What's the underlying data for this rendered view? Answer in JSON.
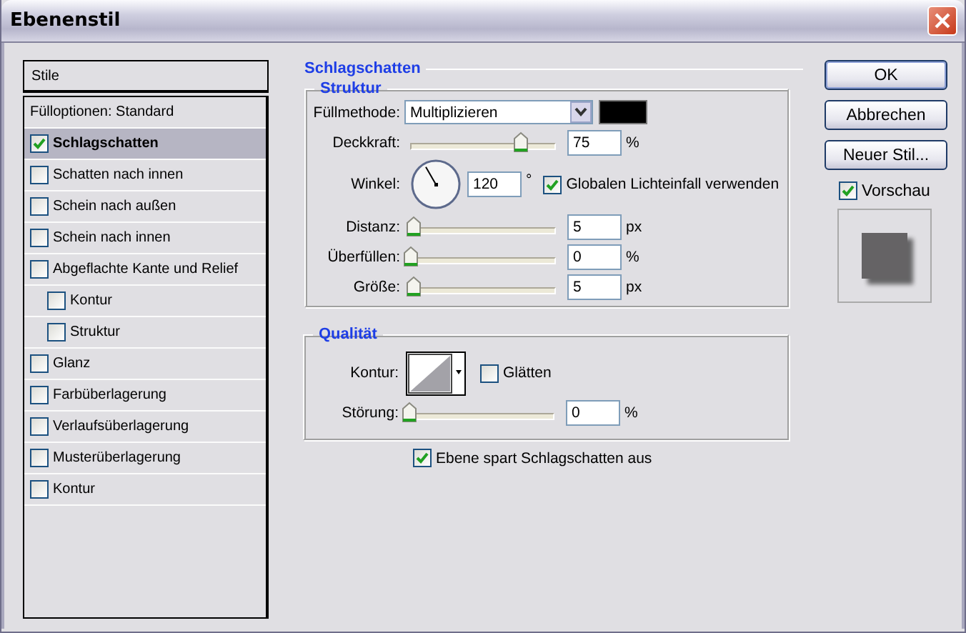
{
  "window": {
    "title": "Ebenenstil"
  },
  "styles": {
    "header": "Stile",
    "items": [
      {
        "label": "Fülloptionen: Standard",
        "kind": "option",
        "selected": false
      },
      {
        "label": "Schlagschatten",
        "kind": "style",
        "checked": true,
        "selected": true
      },
      {
        "label": "Schatten nach innen",
        "kind": "style",
        "checked": false,
        "selected": false
      },
      {
        "label": "Schein nach außen",
        "kind": "style",
        "checked": false,
        "selected": false
      },
      {
        "label": "Schein nach innen",
        "kind": "style",
        "checked": false,
        "selected": false
      },
      {
        "label": "Abgeflachte Kante und Relief",
        "kind": "style",
        "checked": false,
        "selected": false,
        "children": [
          {
            "label": "Kontur",
            "kind": "style",
            "checked": false,
            "selected": false
          },
          {
            "label": "Struktur",
            "kind": "style",
            "checked": false,
            "selected": false
          }
        ]
      },
      {
        "label": "Glanz",
        "kind": "style",
        "checked": false,
        "selected": false
      },
      {
        "label": "Farbüberlagerung",
        "kind": "style",
        "checked": false,
        "selected": false
      },
      {
        "label": "Verlaufsüberlagerung",
        "kind": "style",
        "checked": false,
        "selected": false
      },
      {
        "label": "Musterüberlagerung",
        "kind": "style",
        "checked": false,
        "selected": false
      },
      {
        "label": "Kontur",
        "kind": "style",
        "checked": false,
        "selected": false
      }
    ]
  },
  "panel": {
    "title": "Schlagschatten",
    "structure": {
      "title": "Struktur",
      "rows": [
        {
          "kind": "dropdown",
          "label": "Füllmethode:",
          "value": "Multiplizieren"
        },
        {
          "kind": "slider",
          "label": "Deckkraft:",
          "level": 0.75,
          "value": "75",
          "unit": "%"
        },
        {
          "kind": "angle",
          "label": "Winkel:",
          "value": "120",
          "unit": "°",
          "option": {
            "label": "Globalen Lichteinfall verwenden",
            "checked": true
          }
        },
        {
          "kind": "slider",
          "label": "Distanz:",
          "level": 0.02,
          "value": "5",
          "unit": "px"
        },
        {
          "kind": "slider",
          "label": "Überfüllen:",
          "level": 0,
          "value": "0",
          "unit": "%"
        },
        {
          "kind": "slider",
          "label": "Größe:",
          "level": 0.02,
          "value": "5",
          "unit": "px"
        }
      ]
    },
    "quality": {
      "title": "Qualität",
      "rows": [
        {
          "kind": "contour",
          "label": "Kontur:",
          "option": {
            "label": "Glätten",
            "checked": false
          }
        },
        {
          "kind": "slider",
          "label": "Störung:",
          "level": 0,
          "value": "0",
          "unit": "%"
        }
      ]
    },
    "knockout": {
      "label": "Ebene spart Schlagschatten aus",
      "checked": true
    }
  },
  "actions": {
    "buttons": [
      {
        "label": "OK",
        "default": true
      },
      {
        "label": "Abbrechen",
        "default": false
      },
      {
        "label": "Neuer Stil...",
        "default": false
      }
    ],
    "preview": {
      "label": "Vorschau",
      "checked": true
    }
  }
}
